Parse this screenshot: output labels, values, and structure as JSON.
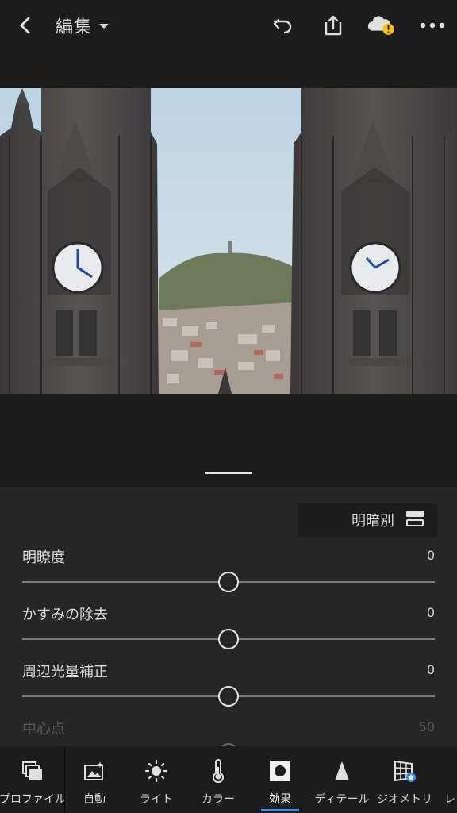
{
  "header": {
    "title": "編集",
    "back_icon": "chevron-left-icon",
    "undo_icon": "undo-icon",
    "share_icon": "share-icon",
    "cloud_icon": "cloud-warning-icon",
    "more_icon": "more-dots-icon",
    "warning_color": "#f5c518"
  },
  "photo": {
    "description_icon": "photo-canvas"
  },
  "panel": {
    "mode_label": "明暗別",
    "mode_icon": "split-view-icon",
    "sliders": [
      {
        "label": "明瞭度",
        "value": "0",
        "position": 0.5
      },
      {
        "label": "かすみの除去",
        "value": "0",
        "position": 0.5
      },
      {
        "label": "周辺光量補正",
        "value": "0",
        "position": 0.5
      },
      {
        "label": "中心点",
        "value": "50",
        "position": 0.5
      }
    ]
  },
  "toolbar": {
    "items": [
      {
        "label": "プロファイル",
        "icon": "profiles-icon"
      },
      {
        "label": "自動",
        "icon": "auto-icon"
      },
      {
        "label": "ライト",
        "icon": "light-icon"
      },
      {
        "label": "カラー",
        "icon": "color-icon"
      },
      {
        "label": "効果",
        "icon": "effects-icon",
        "active": true
      },
      {
        "label": "ディテール",
        "icon": "detail-icon"
      },
      {
        "label": "ジオメトリ",
        "icon": "geometry-icon"
      },
      {
        "label": "レ",
        "icon": "lens-icon"
      }
    ],
    "active_color": "#3b8bea"
  }
}
